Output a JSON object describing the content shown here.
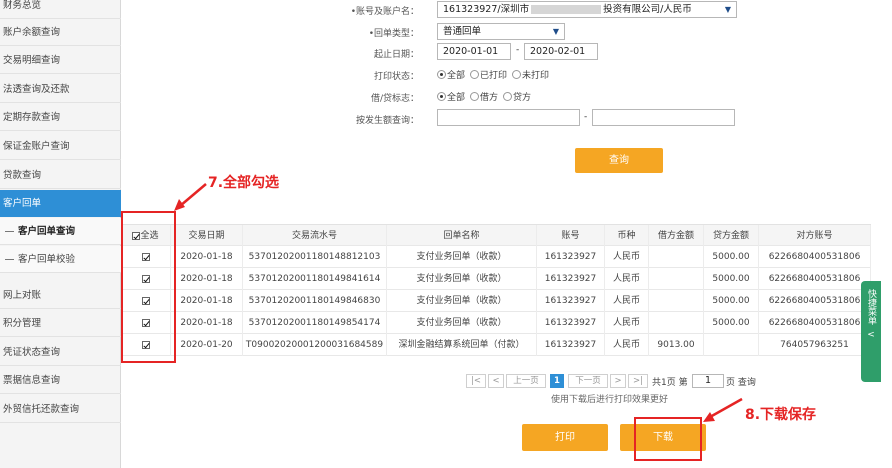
{
  "sidebar": {
    "items": [
      {
        "label": "财务总览"
      },
      {
        "label": "账户余额查询"
      },
      {
        "label": "交易明细查询"
      },
      {
        "label": "法透查询及还款"
      },
      {
        "label": "定期存款查询"
      },
      {
        "label": "保证金账户查询"
      },
      {
        "label": "贷款查询"
      },
      {
        "label": "客户回单"
      },
      {
        "label": "客户回单查询"
      },
      {
        "label": "客户回单校验"
      },
      {
        "label": "网上对账"
      },
      {
        "label": "积分管理"
      },
      {
        "label": "凭证状态查询"
      },
      {
        "label": "票据信息查询"
      },
      {
        "label": "外贸信托还款查询"
      }
    ]
  },
  "form": {
    "account_label": "•账号及账户名：",
    "account_value": "161323927/深圳市",
    "account_value_tail": "投资有限公司/人民币",
    "receipt_type_label": "•回单类型：",
    "receipt_type_value": "普通回单",
    "date_label": "起止日期：",
    "date_from": "2020-01-01",
    "date_sep": "-",
    "date_to": "2020-02-01",
    "print_status_label": "打印状态：",
    "print_status_options": [
      "全部",
      "已打印",
      "未打印"
    ],
    "print_status_selected": "全部",
    "debit_credit_label": "借/贷标志：",
    "debit_credit_options": [
      "全部",
      "借方",
      "贷方"
    ],
    "debit_credit_selected": "全部",
    "amount_label": "按发生额查询：",
    "amount_sep": "-",
    "query_button": "查询"
  },
  "table": {
    "select_all_label": "全选",
    "columns": [
      "交易日期",
      "交易流水号",
      "回单名称",
      "账号",
      "币种",
      "借方金额",
      "贷方金额",
      "对方账号"
    ],
    "rows": [
      {
        "checked": true,
        "date": "2020-01-18",
        "serial": "5370120200118014881210​3",
        "name": "支付业务回单（收款）",
        "account": "161323927",
        "currency": "人民币",
        "debit": "",
        "credit": "5000.00",
        "counter": "6226680400531806"
      },
      {
        "checked": true,
        "date": "2020-01-18",
        "serial": "5370120200118014984161​4",
        "name": "支付业务回单（收款）",
        "account": "161323927",
        "currency": "人民币",
        "debit": "",
        "credit": "5000.00",
        "counter": "6226680400531806"
      },
      {
        "checked": true,
        "date": "2020-01-18",
        "serial": "5370120200118014984683​0",
        "name": "支付业务回单（收款）",
        "account": "161323927",
        "currency": "人民币",
        "debit": "",
        "credit": "5000.00",
        "counter": "6226680400531806"
      },
      {
        "checked": true,
        "date": "2020-01-18",
        "serial": "5370120200118014985417​4",
        "name": "支付业务回单（收款）",
        "account": "161323927",
        "currency": "人民币",
        "debit": "",
        "credit": "5000.00",
        "counter": "6226680400531806"
      },
      {
        "checked": true,
        "date": "2020-01-20",
        "serial": "T090020200012000316845​89",
        "name": "深圳金融结算系统回单（付款）",
        "account": "161323927",
        "currency": "人民币",
        "debit": "9013.00",
        "credit": "",
        "counter": "764057963251"
      }
    ]
  },
  "pager": {
    "first": "|<",
    "prev_arrow": "<",
    "prev": "上一页",
    "current": "1",
    "next": "下一页",
    "next_arrow": ">",
    "last": ">|",
    "total_text": "共1页 第",
    "page_input": "1",
    "go_text": "页 查询",
    "hint": "使用下载后进行打印效果更好"
  },
  "actions": {
    "print": "打印",
    "download": "下载"
  },
  "annotations": {
    "step7": "7.全部勾选",
    "step8": "8.下载保存"
  },
  "quick_menu": "快捷菜单",
  "quick_menu_arrow": "<",
  "colors": {
    "accent_blue": "#2e8fd6",
    "orange": "#f5a623",
    "annotation_red": "#e52424",
    "quick_green": "#2f9e6a"
  }
}
